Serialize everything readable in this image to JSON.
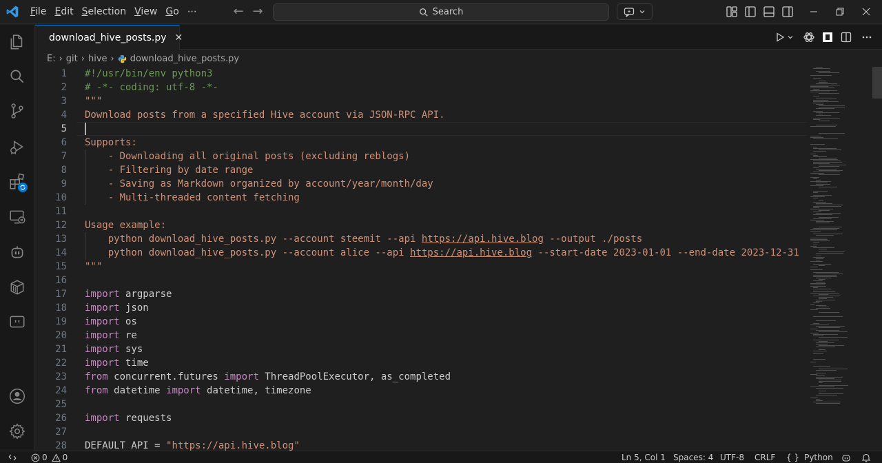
{
  "menu": [
    "File",
    "Edit",
    "Selection",
    "View",
    "Go",
    "⋯"
  ],
  "search": {
    "placeholder": "Search"
  },
  "tab": {
    "label": "download_hive_posts.py",
    "close": "✕"
  },
  "breadcrumb": [
    "E:",
    "git",
    "hive",
    "download_hive_posts.py"
  ],
  "editor": {
    "lines": [
      {
        "n": "1",
        "segs": [
          {
            "c": "c-comment",
            "t": "#!/usr/bin/env python3"
          }
        ]
      },
      {
        "n": "2",
        "segs": [
          {
            "c": "c-comment",
            "t": "# -*- coding: utf-8 -*-"
          }
        ]
      },
      {
        "n": "3",
        "segs": [
          {
            "c": "c-string",
            "t": "\"\"\""
          }
        ]
      },
      {
        "n": "4",
        "segs": [
          {
            "c": "c-string",
            "t": "Download posts from a specified Hive account via JSON-RPC API."
          }
        ]
      },
      {
        "n": "5",
        "segs": []
      },
      {
        "n": "6",
        "segs": [
          {
            "c": "c-string",
            "t": "Supports:"
          }
        ]
      },
      {
        "n": "7",
        "segs": [
          {
            "c": "c-string",
            "t": "    - Downloading all original posts (excluding reblogs)"
          }
        ]
      },
      {
        "n": "8",
        "segs": [
          {
            "c": "c-string",
            "t": "    - Filtering by date range"
          }
        ]
      },
      {
        "n": "9",
        "segs": [
          {
            "c": "c-string",
            "t": "    - Saving as Markdown organized by account/year/month/day"
          }
        ]
      },
      {
        "n": "10",
        "segs": [
          {
            "c": "c-string",
            "t": "    - Multi-threaded content fetching"
          }
        ]
      },
      {
        "n": "11",
        "segs": []
      },
      {
        "n": "12",
        "segs": [
          {
            "c": "c-string",
            "t": "Usage example:"
          }
        ]
      },
      {
        "n": "13",
        "segs": [
          {
            "c": "c-string",
            "t": "    python download_hive_posts.py --account steemit --api "
          },
          {
            "c": "c-link",
            "t": "https://api.hive.blog"
          },
          {
            "c": "c-string",
            "t": " --output ./posts"
          }
        ]
      },
      {
        "n": "14",
        "segs": [
          {
            "c": "c-string",
            "t": "    python download_hive_posts.py --account alice --api "
          },
          {
            "c": "c-link",
            "t": "https://api.hive.blog"
          },
          {
            "c": "c-string",
            "t": " --start-date 2023-01-01 --end-date 2023-12-31"
          }
        ]
      },
      {
        "n": "15",
        "segs": [
          {
            "c": "c-string",
            "t": "\"\"\""
          }
        ]
      },
      {
        "n": "16",
        "segs": []
      },
      {
        "n": "17",
        "segs": [
          {
            "c": "c-kw",
            "t": "import"
          },
          {
            "c": "c-text",
            "t": " argparse"
          }
        ]
      },
      {
        "n": "18",
        "segs": [
          {
            "c": "c-kw",
            "t": "import"
          },
          {
            "c": "c-text",
            "t": " json"
          }
        ]
      },
      {
        "n": "19",
        "segs": [
          {
            "c": "c-kw",
            "t": "import"
          },
          {
            "c": "c-text",
            "t": " os"
          }
        ]
      },
      {
        "n": "20",
        "segs": [
          {
            "c": "c-kw",
            "t": "import"
          },
          {
            "c": "c-text",
            "t": " re"
          }
        ]
      },
      {
        "n": "21",
        "segs": [
          {
            "c": "c-kw",
            "t": "import"
          },
          {
            "c": "c-text",
            "t": " sys"
          }
        ]
      },
      {
        "n": "22",
        "segs": [
          {
            "c": "c-kw",
            "t": "import"
          },
          {
            "c": "c-text",
            "t": " time"
          }
        ]
      },
      {
        "n": "23",
        "segs": [
          {
            "c": "c-kw",
            "t": "from"
          },
          {
            "c": "c-text",
            "t": " concurrent.futures "
          },
          {
            "c": "c-kw",
            "t": "import"
          },
          {
            "c": "c-text",
            "t": " ThreadPoolExecutor, as_completed"
          }
        ]
      },
      {
        "n": "24",
        "segs": [
          {
            "c": "c-kw",
            "t": "from"
          },
          {
            "c": "c-text",
            "t": " datetime "
          },
          {
            "c": "c-kw",
            "t": "import"
          },
          {
            "c": "c-text",
            "t": " datetime, timezone"
          }
        ]
      },
      {
        "n": "25",
        "segs": []
      },
      {
        "n": "26",
        "segs": [
          {
            "c": "c-kw",
            "t": "import"
          },
          {
            "c": "c-text",
            "t": " requests"
          }
        ]
      },
      {
        "n": "27",
        "segs": []
      },
      {
        "n": "28",
        "segs": [
          {
            "c": "c-text",
            "t": "DEFAULT_API = "
          },
          {
            "c": "c-string",
            "t": "\"https://api.hive.blog\""
          }
        ]
      }
    ]
  },
  "status": {
    "errors": "0",
    "warnings": "0",
    "position": "Ln 5, Col 1",
    "spaces": "Spaces: 4",
    "encoding": "UTF-8",
    "eol": "CRLF",
    "language_icon": "{ }",
    "language": "Python"
  },
  "colors": {
    "accent": "#0078d4",
    "badge": "#0078d4"
  }
}
